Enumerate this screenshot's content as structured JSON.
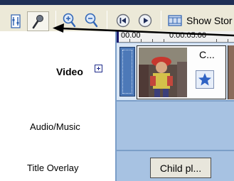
{
  "toolbar": {
    "buttons": [
      {
        "icon": "set-audio-levels-icon"
      },
      {
        "icon": "narrate-timeline-icon"
      },
      {
        "icon": "zoom-in-icon"
      },
      {
        "icon": "zoom-out-icon"
      },
      {
        "icon": "rewind-timeline-icon"
      },
      {
        "icon": "play-timeline-icon"
      }
    ],
    "show_storyboard_label": "Show Stor"
  },
  "ruler": {
    "times": [
      "00.00",
      "0:00:05.00"
    ]
  },
  "tracks": {
    "video": {
      "label": "Video"
    },
    "audio": {
      "label": "Audio/Music"
    },
    "title": {
      "label": "Title Overlay"
    }
  },
  "clip": {
    "name": "C..."
  },
  "title_clip": {
    "name": "Child pl..."
  },
  "colors": {
    "track_bg": "#a7c2e2",
    "toolbar_bg": "#ece9d8",
    "transition": "#4d79b8"
  }
}
